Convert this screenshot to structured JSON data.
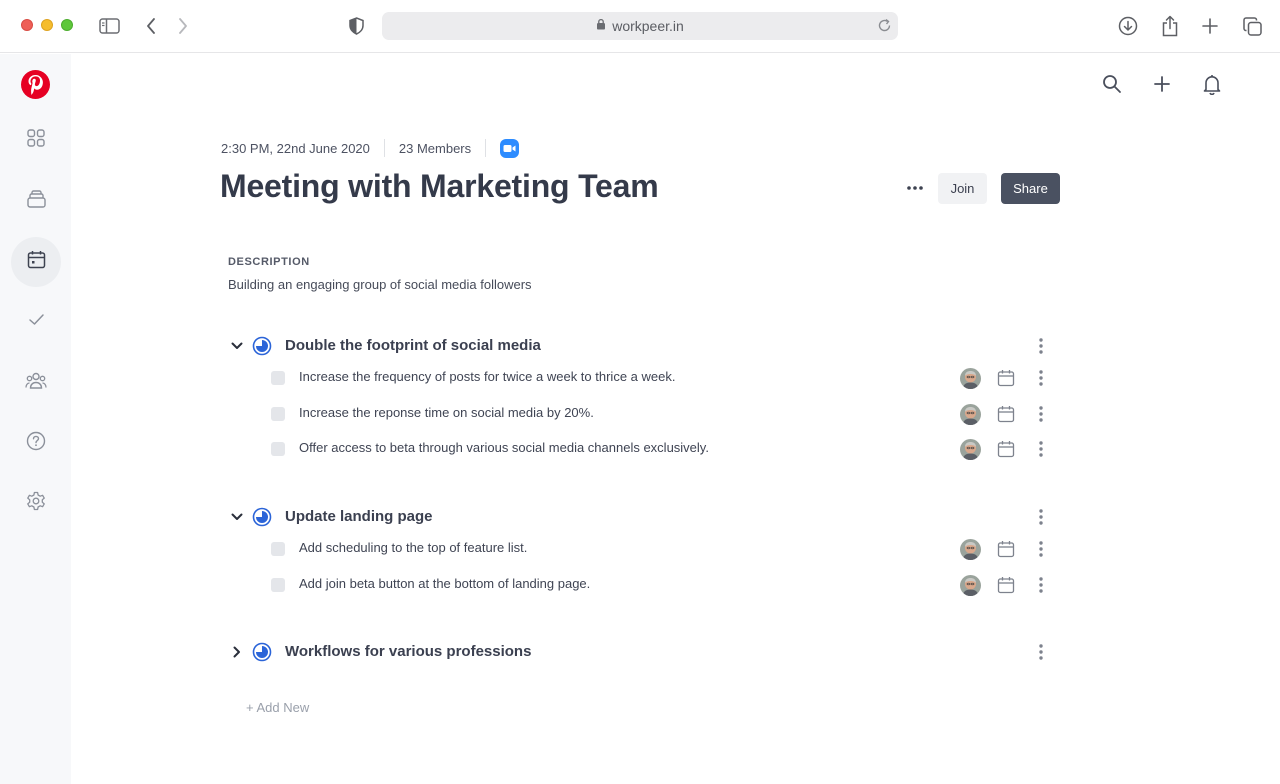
{
  "browser": {
    "url": "workpeer.in"
  },
  "sidebar": {
    "items": [
      {
        "icon": "grid-icon"
      },
      {
        "icon": "inbox-icon"
      },
      {
        "icon": "calendar-icon",
        "active": true
      },
      {
        "icon": "check-icon"
      },
      {
        "icon": "team-icon"
      },
      {
        "icon": "help-icon"
      },
      {
        "icon": "settings-icon"
      }
    ]
  },
  "meeting": {
    "datetime": "2:30 PM, 22nd June 2020",
    "members": "23 Members",
    "title": "Meeting with Marketing Team",
    "join_label": "Join",
    "share_label": "Share",
    "description_label": "DESCRIPTION",
    "description": "Building an engaging group of social media followers"
  },
  "goals": [
    {
      "title": "Double the footprint of social media",
      "expanded": true,
      "progress": 0.75,
      "tasks": [
        {
          "text": "Increase the frequency of posts for twice a week to thrice a week."
        },
        {
          "text": "Increase the reponse time on social media by 20%."
        },
        {
          "text": "Offer access to beta through various social media channels exclusively."
        }
      ]
    },
    {
      "title": "Update landing page",
      "expanded": true,
      "progress": 0.75,
      "tasks": [
        {
          "text": "Add scheduling to the top of feature list."
        },
        {
          "text": "Add join beta button at the bottom of landing page."
        }
      ]
    },
    {
      "title": "Workflows for various professions",
      "expanded": false,
      "progress": 0.75,
      "tasks": []
    }
  ],
  "add_new_label": "+ Add New",
  "colors": {
    "accent": "#2b64d8",
    "brand": "#e60023",
    "share_button": "#4a5161",
    "zoom": "#2d8cff"
  }
}
